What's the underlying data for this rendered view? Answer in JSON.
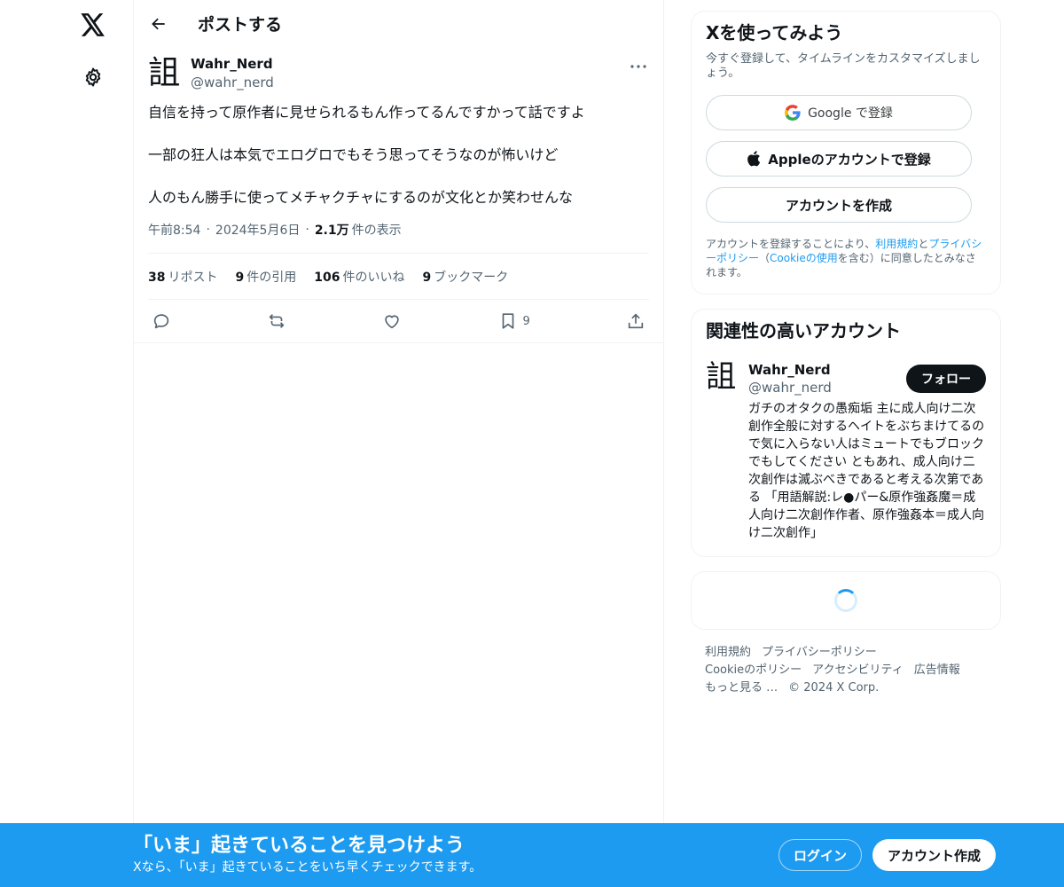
{
  "nav": {
    "logo_icon": "x-logo-icon",
    "settings_icon": "gear-icon"
  },
  "header": {
    "title": "ポストする",
    "back_icon": "arrow-left-icon"
  },
  "post": {
    "avatar_glyph": "詛",
    "author_name": "Wahr_Nerd",
    "author_handle": "@wahr_nerd",
    "paragraphs": [
      "自信を持って原作者に見せられるもん作ってるんですかって話ですよ",
      "一部の狂人は本気でエログロでもそう思ってそうなのが怖いけど",
      "人のもん勝手に使ってメチャクチャにするのが文化とか笑わせんな"
    ],
    "time": "午前8:54",
    "date": "2024年5月6日",
    "views_count": "2.1万",
    "views_label": "件の表示",
    "stats": {
      "reposts_count": "38",
      "reposts_label": "リポスト",
      "quotes_count": "9",
      "quotes_label": "件の引用",
      "likes_count": "106",
      "likes_label": "件のいいね",
      "bookmarks_count": "9",
      "bookmarks_label": "ブックマーク"
    },
    "bookmark_action_count": "9"
  },
  "signup_card": {
    "title": "Xを使ってみよう",
    "subtitle": "今すぐ登録して、タイムラインをカスタマイズしましょう。",
    "google_label": "Google で登録",
    "apple_label": "Appleのアカウントで登録",
    "create_label": "アカウントを作成",
    "legal_pre": "アカウントを登録することにより、",
    "legal_terms": "利用規約",
    "legal_and": "と",
    "legal_privacy": "プライバシーポリシー",
    "legal_paren_open": "（",
    "legal_cookie": "Cookieの使用",
    "legal_post": "を含む）に同意したとみなされます。"
  },
  "related_card": {
    "title": "関連性の高いアカウント",
    "avatar_glyph": "詛",
    "name": "Wahr_Nerd",
    "handle": "@wahr_nerd",
    "follow_label": "フォロー",
    "bio": "ガチのオタクの愚痴垢 主に成人向け二次創作全般に対するヘイトをぶちまけてるので気に入らない人はミュートでもブロックでもしてください ともあれ、成人向け二次創作は滅ぶべきであると考える次第である 「用語解説:レ●パー&原作強姦魔＝成人向け二次創作作者、原作強姦本＝成人向け二次創作」"
  },
  "footer": {
    "terms": "利用規約",
    "privacy": "プライバシーポリシー",
    "cookie": "Cookieのポリシー",
    "accessibility": "アクセシビリティ",
    "ads": "広告情報",
    "more": "もっと見る …",
    "copyright": "© 2024 X Corp."
  },
  "bottom_bar": {
    "title": "「いま」起きていることを見つけよう",
    "subtitle": "Xなら、「いま」起きていることをいち早くチェックできます。",
    "login_label": "ログイン",
    "signup_label": "アカウント作成"
  },
  "colors": {
    "accent": "#1d9bf0",
    "text": "#0f1419",
    "muted": "#536471",
    "border": "#eff3f4"
  }
}
